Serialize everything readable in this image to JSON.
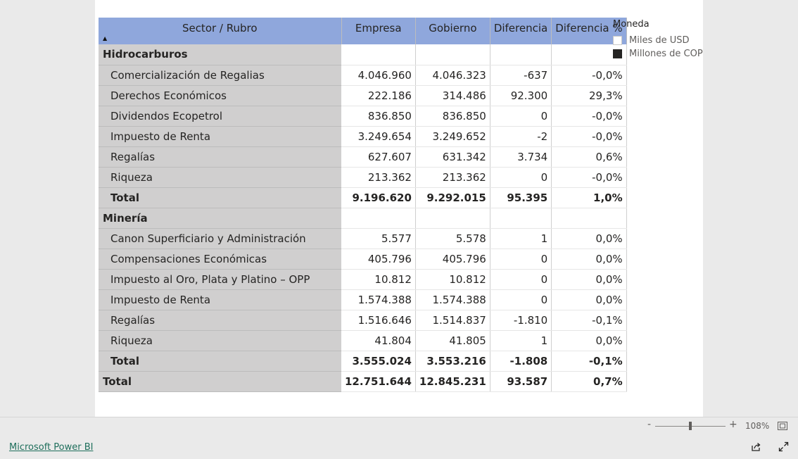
{
  "table": {
    "headers": {
      "sector": "Sector / Rubro",
      "empresa": "Empresa",
      "gobierno": "Gobierno",
      "diferencia": "Diferencia",
      "diferencia_pct": "Diferencia %"
    },
    "sort_indicator": "▲",
    "groups": [
      {
        "name": "Hidrocarburos",
        "rows": [
          {
            "label": "Comercialización de Regalias",
            "empresa": "4.046.960",
            "gobierno": "4.046.323",
            "diferencia": "-637",
            "diferencia_pct": "-0,0%"
          },
          {
            "label": "Derechos Económicos",
            "empresa": "222.186",
            "gobierno": "314.486",
            "diferencia": "92.300",
            "diferencia_pct": "29,3%"
          },
          {
            "label": "Dividendos Ecopetrol",
            "empresa": "836.850",
            "gobierno": "836.850",
            "diferencia": "0",
            "diferencia_pct": "-0,0%"
          },
          {
            "label": "Impuesto de Renta",
            "empresa": "3.249.654",
            "gobierno": "3.249.652",
            "diferencia": "-2",
            "diferencia_pct": "-0,0%"
          },
          {
            "label": "Regalías",
            "empresa": "627.607",
            "gobierno": "631.342",
            "diferencia": "3.734",
            "diferencia_pct": "0,6%"
          },
          {
            "label": "Riqueza",
            "empresa": "213.362",
            "gobierno": "213.362",
            "diferencia": "0",
            "diferencia_pct": "-0,0%"
          }
        ],
        "total": {
          "label": "Total",
          "empresa": "9.196.620",
          "gobierno": "9.292.015",
          "diferencia": "95.395",
          "diferencia_pct": "1,0%"
        }
      },
      {
        "name": "Minería",
        "rows": [
          {
            "label": "Canon Superficiario y Administración",
            "empresa": "5.577",
            "gobierno": "5.578",
            "diferencia": "1",
            "diferencia_pct": "0,0%"
          },
          {
            "label": "Compensaciones Económicas",
            "empresa": "405.796",
            "gobierno": "405.796",
            "diferencia": "0",
            "diferencia_pct": "0,0%"
          },
          {
            "label": "Impuesto al Oro, Plata y Platino – OPP",
            "empresa": "10.812",
            "gobierno": "10.812",
            "diferencia": "0",
            "diferencia_pct": "0,0%"
          },
          {
            "label": "Impuesto de Renta",
            "empresa": "1.574.388",
            "gobierno": "1.574.388",
            "diferencia": "0",
            "diferencia_pct": "0,0%"
          },
          {
            "label": "Regalías",
            "empresa": "1.516.646",
            "gobierno": "1.514.837",
            "diferencia": "-1.810",
            "diferencia_pct": "-0,1%"
          },
          {
            "label": "Riqueza",
            "empresa": "41.804",
            "gobierno": "41.805",
            "diferencia": "1",
            "diferencia_pct": "0,0%"
          }
        ],
        "total": {
          "label": "Total",
          "empresa": "3.555.024",
          "gobierno": "3.553.216",
          "diferencia": "-1.808",
          "diferencia_pct": "-0,1%"
        }
      }
    ],
    "grand_total": {
      "label": "Total",
      "empresa": "12.751.644",
      "gobierno": "12.845.231",
      "diferencia": "93.587",
      "diferencia_pct": "0,7%"
    }
  },
  "slicer": {
    "title": "Moneda",
    "options": [
      {
        "label": "Miles de USD",
        "checked": false
      },
      {
        "label": "Millones de COP",
        "checked": true
      }
    ]
  },
  "zoom": {
    "minus": "-",
    "plus": "+",
    "level": "108%",
    "fraction": 0.5
  },
  "footer": {
    "link_label": "Microsoft Power BI"
  },
  "icons": {
    "fit": "fit-to-page-icon",
    "share": "share-icon",
    "expand": "expand-icon"
  },
  "colors": {
    "header_bg": "#8fa7dc",
    "row_header_bg": "#d0cfcf",
    "checked_box": "#252423",
    "link": "#1f6f5c"
  }
}
